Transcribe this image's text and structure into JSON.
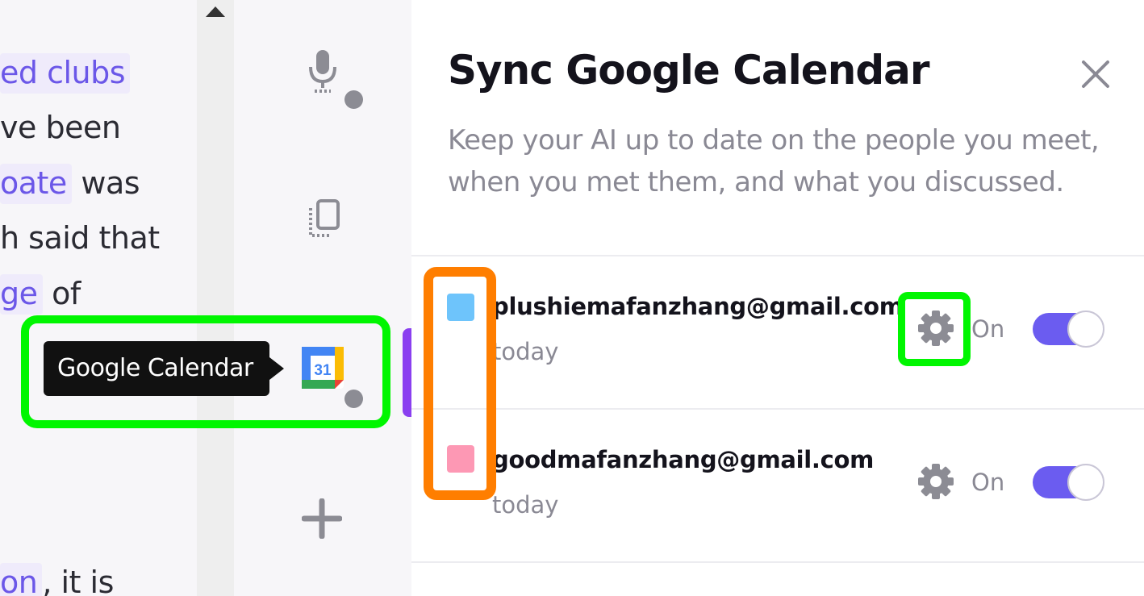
{
  "document": {
    "lines": [
      {
        "highlight": "ed clubs",
        "rest": ""
      },
      {
        "highlight": "",
        "rest": "ve been"
      },
      {
        "highlight": "oate",
        "rest": " was"
      },
      {
        "highlight": "",
        "rest": "h said that"
      },
      {
        "highlight": "ge",
        "rest": " of"
      },
      {
        "highlight": "on",
        "rest": ", it is"
      }
    ]
  },
  "rail": {
    "items": [
      {
        "name": "microphone-icon",
        "has_dot": true
      },
      {
        "name": "clipboard-icon",
        "has_dot": false
      },
      {
        "name": "google-calendar-icon",
        "has_dot": true,
        "badge": "31"
      },
      {
        "name": "add-icon",
        "has_dot": false
      }
    ],
    "tooltip": "Google Calendar"
  },
  "panel": {
    "title": "Sync Google Calendar",
    "description": "Keep your AI up to date on the people you meet, when you met them, and what you discussed.",
    "accounts": [
      {
        "email": "plushiemafanzhang@gmail.com",
        "when": "today",
        "status": "On",
        "enabled": true,
        "color": "#6ec4fb"
      },
      {
        "email": "goodmafanzhang@gmail.com",
        "when": "today",
        "status": "On",
        "enabled": true,
        "color": "#fd98b4"
      }
    ]
  },
  "colors": {
    "accent": "#6b5cf0",
    "highlight_text": "#6b57e8",
    "annotation_green": "#00f600",
    "annotation_orange": "#ff7e00"
  }
}
